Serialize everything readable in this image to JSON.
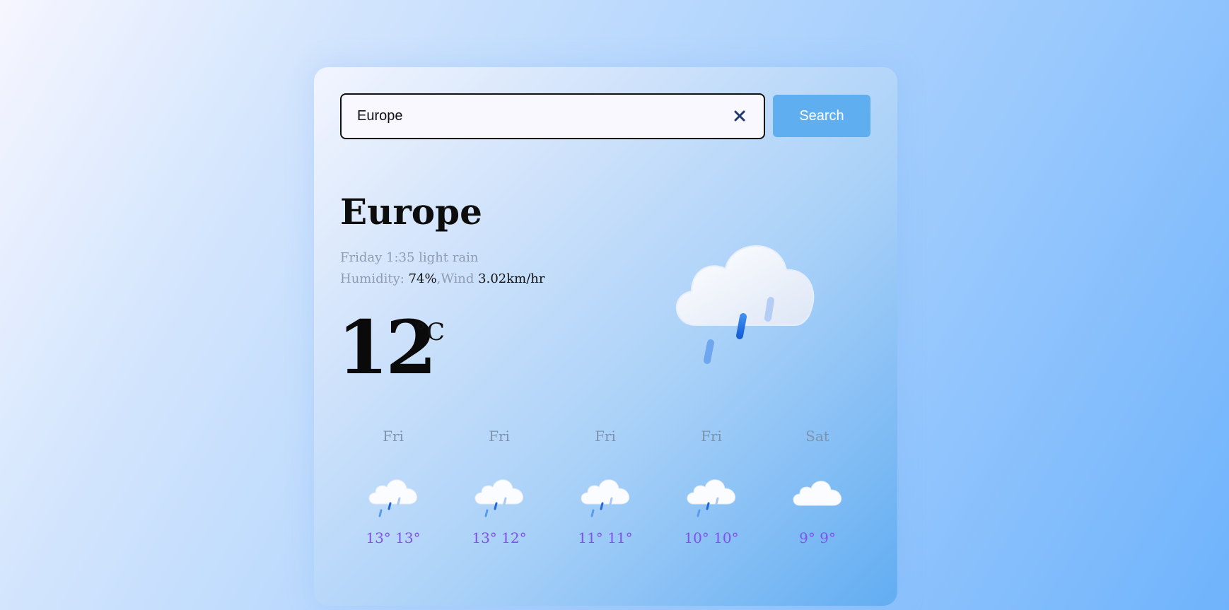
{
  "search": {
    "value": "Europe",
    "button_label": "Search"
  },
  "current": {
    "city": "Europe",
    "day_time": "Friday 1:35",
    "condition": "light rain",
    "humidity_label": "Humidity:",
    "humidity_value": "74%",
    "separator": ",",
    "wind_label": "Wind",
    "wind_value": "3.02km/hr",
    "temperature": "12",
    "unit": "°C",
    "icon": "cloud-rain-icon"
  },
  "forecast": [
    {
      "day": "Fri",
      "temps": "13° 13°",
      "icon": "cloud-rain-icon"
    },
    {
      "day": "Fri",
      "temps": "13° 12°",
      "icon": "cloud-rain-icon"
    },
    {
      "day": "Fri",
      "temps": "11° 11°",
      "icon": "cloud-rain-icon"
    },
    {
      "day": "Fri",
      "temps": "10° 10°",
      "icon": "cloud-rain-icon"
    },
    {
      "day": "Sat",
      "temps": "9° 9°",
      "icon": "cloud-icon"
    }
  ],
  "colors": {
    "accent_button": "#5faeef",
    "forecast_temp": "#8250f0"
  }
}
